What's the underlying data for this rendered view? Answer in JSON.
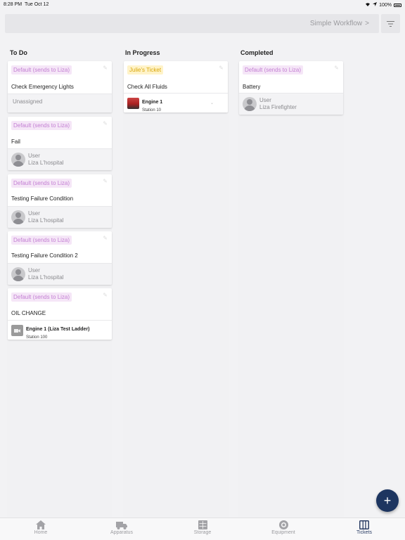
{
  "status": {
    "time": "8:28 PM",
    "date": "Tue Oct 12",
    "battery": "100%"
  },
  "header": {
    "workflow_label": "Simple Workflow",
    "chevron": ">"
  },
  "columns": [
    {
      "title": "To Do",
      "cards": [
        {
          "badge": "Default (sends to Liza)",
          "title": "Check Emergency Lights",
          "assignee": "Unassigned"
        },
        {
          "badge": "Default (sends to Liza)",
          "title": "Fail",
          "user_role": "User",
          "user_name": "Liza L'hospital"
        },
        {
          "badge": "Default (sends to Liza)",
          "title": "Testing Failure Condition",
          "user_role": "User",
          "user_name": "Liza L'hospital"
        },
        {
          "badge": "Default (sends to Liza)",
          "title": "Testing Failure Condition 2",
          "user_role": "User",
          "user_name": "Liza L'hospital"
        },
        {
          "badge": "Default (sends to Liza)",
          "title": "OIL CHANGE",
          "equipment_name": "Engine 1 (Liza Test Ladder)",
          "equipment_station": "Station 100"
        }
      ]
    },
    {
      "title": "In Progress",
      "cards": [
        {
          "badge": "Julie's Ticket",
          "title": "Check All Fluids",
          "equipment_name": "Engine 1",
          "equipment_station": "Station 10"
        }
      ]
    },
    {
      "title": "Completed",
      "cards": [
        {
          "badge": "Default (sends to Liza)",
          "title": "Battery",
          "user_role": "User",
          "user_name": "Liza Firefighter"
        }
      ]
    }
  ],
  "fab": {
    "label": "+"
  },
  "tabs": [
    {
      "label": "Home",
      "icon": "home-icon"
    },
    {
      "label": "Apparatus",
      "icon": "truck-icon"
    },
    {
      "label": "Storage",
      "icon": "storage-icon"
    },
    {
      "label": "Equipment",
      "icon": "equipment-icon"
    },
    {
      "label": "Tickets",
      "icon": "tickets-icon",
      "active": true
    }
  ],
  "colors": {
    "accent": "#1d3560",
    "badge_pink_text": "#c37fd3",
    "badge_yellow_text": "#d9a70a"
  }
}
